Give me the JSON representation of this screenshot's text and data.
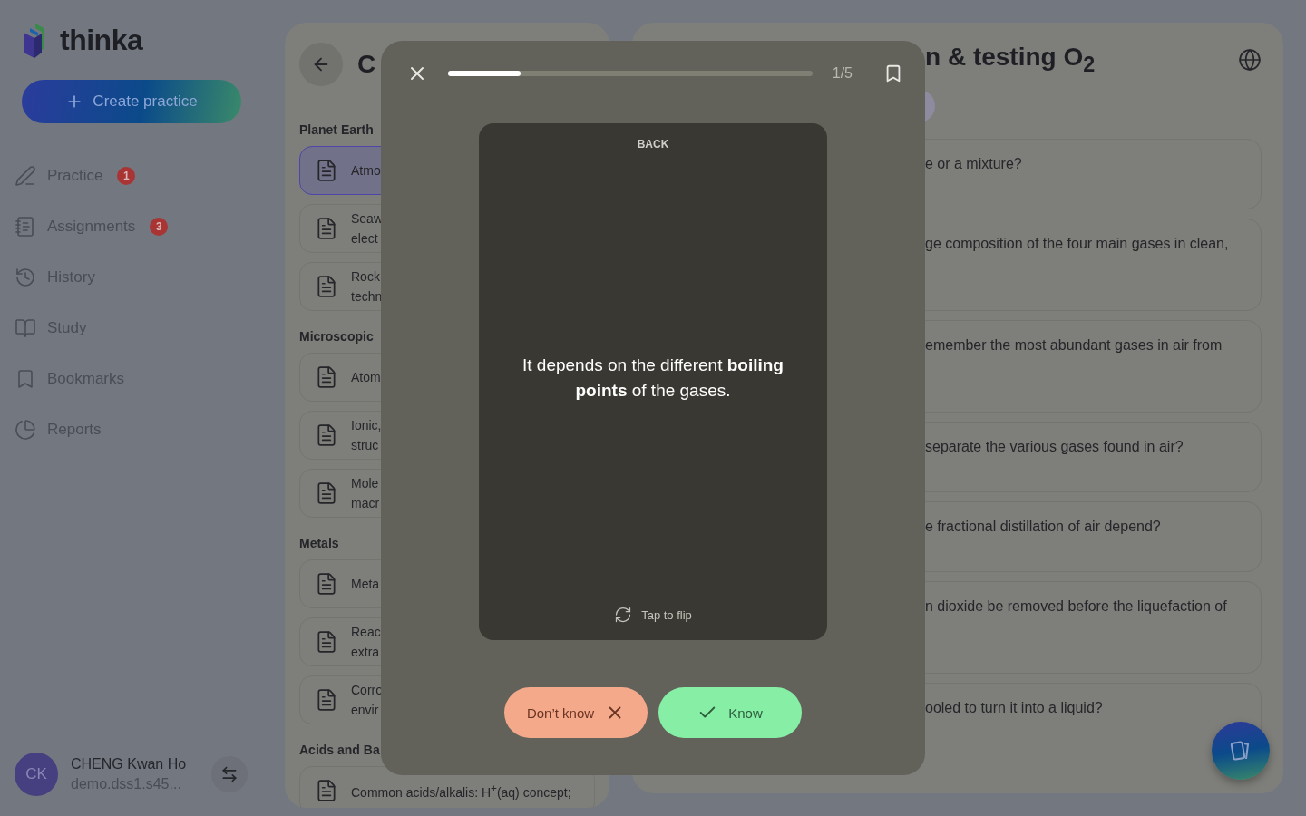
{
  "sidebar": {
    "logo_text": "thinka",
    "create_button": "Create practice",
    "nav": [
      {
        "label": "Practice",
        "badge": "1"
      },
      {
        "label": "Assignments",
        "badge": "3"
      },
      {
        "label": "History"
      },
      {
        "label": "Study"
      },
      {
        "label": "Bookmarks"
      },
      {
        "label": "Reports"
      }
    ],
    "user": {
      "initials": "CK",
      "name": "CHENG Kwan Ho",
      "email": "demo.dss1.s45..."
    }
  },
  "topics_panel": {
    "title": "C",
    "sections": [
      {
        "heading": "Planet Earth",
        "items": [
          {
            "lines": [
              "Atmo"
            ],
            "selected": true
          },
          {
            "lines": [
              "Seaw",
              "elect"
            ],
            "selected": false
          },
          {
            "lines": [
              "Rock",
              "techn"
            ],
            "selected": false
          }
        ]
      },
      {
        "heading": "Microscopic",
        "items": [
          {
            "lines": [
              "Atom"
            ],
            "selected": false
          },
          {
            "lines": [
              "Ionic,",
              "struc"
            ],
            "selected": false
          },
          {
            "lines": [
              "Mole",
              "macr"
            ],
            "selected": false
          }
        ]
      },
      {
        "heading": "Metals",
        "items": [
          {
            "lines": [
              "Meta"
            ],
            "selected": false
          },
          {
            "lines": [
              "Reac",
              "extra"
            ],
            "selected": false
          },
          {
            "lines": [
              "Corro",
              "envir"
            ],
            "selected": false
          }
        ]
      },
      {
        "heading": "Acids and Ba",
        "items": [
          {
            "lines": [
              "Common acids/alkalis: H$^{+}$(aq) concept;"
            ],
            "selected": false
          }
        ]
      }
    ]
  },
  "questions_panel": {
    "title": "n & testing O$_{2}$",
    "questions": [
      {
        "text": "e or a mixture?",
        "tall": false
      },
      {
        "text": "ge composition of the four main gases in clean,",
        "tall": true
      },
      {
        "text": "emember the most abundant gases in air from",
        "tall": true
      },
      {
        "text": "separate the various gases found in air?",
        "tall": false
      },
      {
        "text": "e fractional distillation of air depend?",
        "tall": false
      },
      {
        "text": "n dioxide be removed before the liquefaction of",
        "tall": true
      },
      {
        "text": "ooled to turn it into a liquid?",
        "tall": false
      }
    ]
  },
  "flashcard": {
    "counter": "1/5",
    "progress": {
      "level": 0.2
    },
    "side_label": "BACK",
    "answer": "It depends on the different **boiling points** of the gases.",
    "flip_hint": "Tap to flip",
    "buttons": [
      {
        "label": "Don’t know",
        "kind": "dont_know"
      },
      {
        "label": "Know",
        "kind": "know"
      }
    ]
  }
}
